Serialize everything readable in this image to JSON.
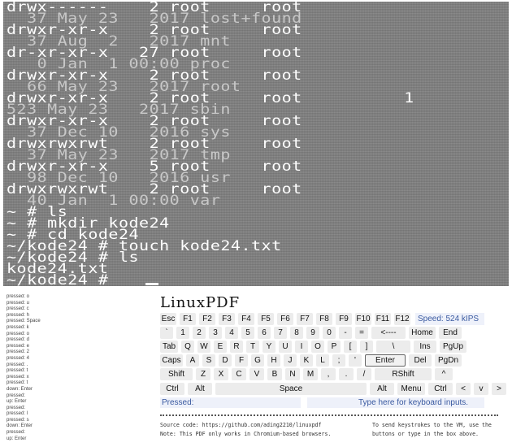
{
  "terminal": {
    "lines": [
      {
        "text": "drwx------    2 root     root",
        "dim": false
      },
      {
        "text": "  37 May 23   2017 lost+found",
        "dim": true
      },
      {
        "text": "drwxr-xr-x    2 root     root",
        "dim": false
      },
      {
        "text": "  37 Aug  2   2017 mnt",
        "dim": true
      },
      {
        "text": "dr-xr-xr-x   27 root     root",
        "dim": false
      },
      {
        "text": "   0 Jan  1 00:00 proc",
        "dim": true
      },
      {
        "text": "drwxr-xr-x    2 root     root",
        "dim": false
      },
      {
        "text": "  66 May 23   2017 root",
        "dim": true
      },
      {
        "text": "drwxr-xr-x    2 root     root          1",
        "dim": false
      },
      {
        "text": "523 May 23   2017 sbin",
        "dim": true
      },
      {
        "text": "drwxr-xr-x    2 root     root",
        "dim": false
      },
      {
        "text": "  37 Dec 10   2016 sys",
        "dim": true
      },
      {
        "text": "drwxrwxrwt    2 root     root",
        "dim": false
      },
      {
        "text": "  37 May 23   2017 tmp",
        "dim": true
      },
      {
        "text": "drwxr-xr-x    5 root     root",
        "dim": false
      },
      {
        "text": "  98 Dec 10   2016 usr",
        "dim": true
      },
      {
        "text": "drwxrwxrwt    2 root     root",
        "dim": false
      },
      {
        "text": "  40 Jan  1 00:00 var",
        "dim": true
      },
      {
        "text": "~ # ls",
        "dim": false
      },
      {
        "text": "~ # mkdir kode24",
        "dim": false
      },
      {
        "text": "~ # cd kode24",
        "dim": false
      },
      {
        "text": "~/kode24 # touch kode24.txt",
        "dim": false
      },
      {
        "text": "~/kode24 # ls",
        "dim": false
      },
      {
        "text": "kode24.txt",
        "dim": false
      },
      {
        "text": "~/kode24 #",
        "dim": false
      }
    ]
  },
  "log": [
    "pressed: o",
    "pressed: u",
    "pressed: c",
    "pressed: h",
    "pressed: Space",
    "pressed: k",
    "pressed: o",
    "pressed: d",
    "pressed: e",
    "pressed: 2",
    "pressed: 4",
    "pressed: .",
    "pressed: t",
    "pressed: x",
    "pressed: t",
    "down: Enter",
    "pressed:",
    "up: Enter",
    "pressed:",
    "pressed: l",
    "pressed: s",
    "down: Enter",
    "pressed:",
    "up: Enter",
    "pressed:"
  ],
  "app_title": "LinuxPDF",
  "speed_text": "Speed: 524 kIPS",
  "keyboard": {
    "rows": [
      [
        {
          "label": "Esc",
          "w": 20
        },
        {
          "label": "F1",
          "w": 20
        },
        {
          "label": "F2",
          "w": 20
        },
        {
          "label": "F3",
          "w": 20
        },
        {
          "label": "F4",
          "w": 20
        },
        {
          "label": "F5",
          "w": 20
        },
        {
          "label": "F6",
          "w": 20
        },
        {
          "label": "F7",
          "w": 20
        },
        {
          "label": "F8",
          "w": 20
        },
        {
          "label": "F9",
          "w": 20
        },
        {
          "label": "F10",
          "w": 20
        },
        {
          "label": "F11",
          "w": 20
        },
        {
          "label": "F12",
          "w": 20
        }
      ],
      [
        {
          "label": "`",
          "w": 16
        },
        {
          "label": "1",
          "w": 16
        },
        {
          "label": "2",
          "w": 16
        },
        {
          "label": "3",
          "w": 16
        },
        {
          "label": "4",
          "w": 16
        },
        {
          "label": "5",
          "w": 16
        },
        {
          "label": "6",
          "w": 16
        },
        {
          "label": "7",
          "w": 16
        },
        {
          "label": "8",
          "w": 16
        },
        {
          "label": "9",
          "w": 16
        },
        {
          "label": "0",
          "w": 16
        },
        {
          "label": "-",
          "w": 16
        },
        {
          "label": "=",
          "w": 16
        },
        {
          "label": "<----",
          "w": 42
        },
        {
          "label": "Home",
          "w": 33
        },
        {
          "label": "End",
          "w": 28
        }
      ],
      [
        {
          "label": "Tab",
          "w": 22
        },
        {
          "label": "Q",
          "w": 16
        },
        {
          "label": "W",
          "w": 16
        },
        {
          "label": "E",
          "w": 16
        },
        {
          "label": "R",
          "w": 16
        },
        {
          "label": "T",
          "w": 16
        },
        {
          "label": "Y",
          "w": 16
        },
        {
          "label": "U",
          "w": 16
        },
        {
          "label": "I",
          "w": 16
        },
        {
          "label": "O",
          "w": 16
        },
        {
          "label": "P",
          "w": 16
        },
        {
          "label": "[",
          "w": 16
        },
        {
          "label": "]",
          "w": 16
        },
        {
          "label": "\\",
          "w": 42
        },
        {
          "label": "Ins",
          "w": 28
        },
        {
          "label": "PgUp",
          "w": 33
        }
      ],
      [
        {
          "label": "Caps",
          "w": 28
        },
        {
          "label": "A",
          "w": 16
        },
        {
          "label": "S",
          "w": 16
        },
        {
          "label": "D",
          "w": 16
        },
        {
          "label": "F",
          "w": 16
        },
        {
          "label": "G",
          "w": 16
        },
        {
          "label": "H",
          "w": 16
        },
        {
          "label": "J",
          "w": 16
        },
        {
          "label": "K",
          "w": 16
        },
        {
          "label": "L",
          "w": 16
        },
        {
          "label": ";",
          "w": 16
        },
        {
          "label": "'",
          "w": 16
        },
        {
          "label": "Enter",
          "w": 50,
          "sel": true
        },
        {
          "label": "Del",
          "w": 28
        },
        {
          "label": "PgDn",
          "w": 33
        }
      ],
      [
        {
          "label": "Shift",
          "w": 40
        },
        {
          "label": "Z",
          "w": 18
        },
        {
          "label": "X",
          "w": 18
        },
        {
          "label": "C",
          "w": 18
        },
        {
          "label": "V",
          "w": 18
        },
        {
          "label": "B",
          "w": 18
        },
        {
          "label": "N",
          "w": 18
        },
        {
          "label": "M",
          "w": 18
        },
        {
          "label": ",",
          "w": 18
        },
        {
          "label": ".",
          "w": 18
        },
        {
          "label": "/",
          "w": 18
        },
        {
          "label": "RShift",
          "w": 70
        },
        {
          "label": "^",
          "w": 22
        }
      ],
      [
        {
          "label": "Ctrl",
          "w": 30
        },
        {
          "label": "Alt",
          "w": 30
        },
        {
          "label": "Space",
          "w": 186
        },
        {
          "label": "Alt",
          "w": 30
        },
        {
          "label": "Menu",
          "w": 34
        },
        {
          "label": "Ctrl",
          "w": 30
        },
        {
          "label": "<",
          "w": 18
        },
        {
          "label": "v",
          "w": 18
        },
        {
          "label": ">",
          "w": 18
        }
      ]
    ]
  },
  "pressed_label": "Pressed:",
  "input_placeholder": "Type here for keyboard inputs.",
  "footer": {
    "source": "Source code: https://github.com/ading2210/linuxpdf",
    "note": "Note: This PDF only works in Chromium-based browsers.",
    "hint1": "To send keystrokes to the VM, use the",
    "hint2": "buttons or type in the box above."
  }
}
